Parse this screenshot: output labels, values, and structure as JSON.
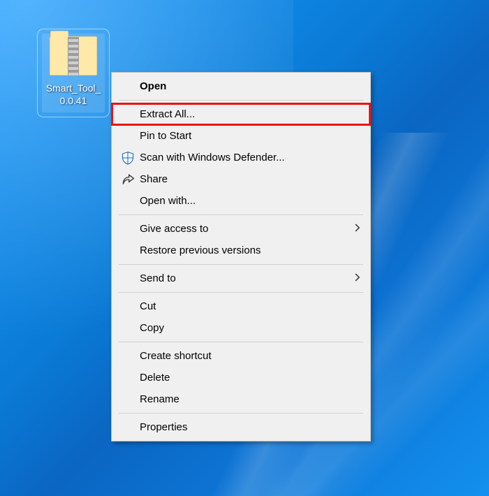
{
  "desktop": {
    "icon": {
      "label_line1": "Smart_Tool_",
      "label_line2": "0.0.41"
    }
  },
  "menu": {
    "open": "Open",
    "extract_all": "Extract All...",
    "pin_to_start": "Pin to Start",
    "scan_defender": "Scan with Windows Defender...",
    "share": "Share",
    "open_with": "Open with...",
    "give_access_to": "Give access to",
    "restore_previous": "Restore previous versions",
    "send_to": "Send to",
    "cut": "Cut",
    "copy": "Copy",
    "create_shortcut": "Create shortcut",
    "delete": "Delete",
    "rename": "Rename",
    "properties": "Properties"
  }
}
